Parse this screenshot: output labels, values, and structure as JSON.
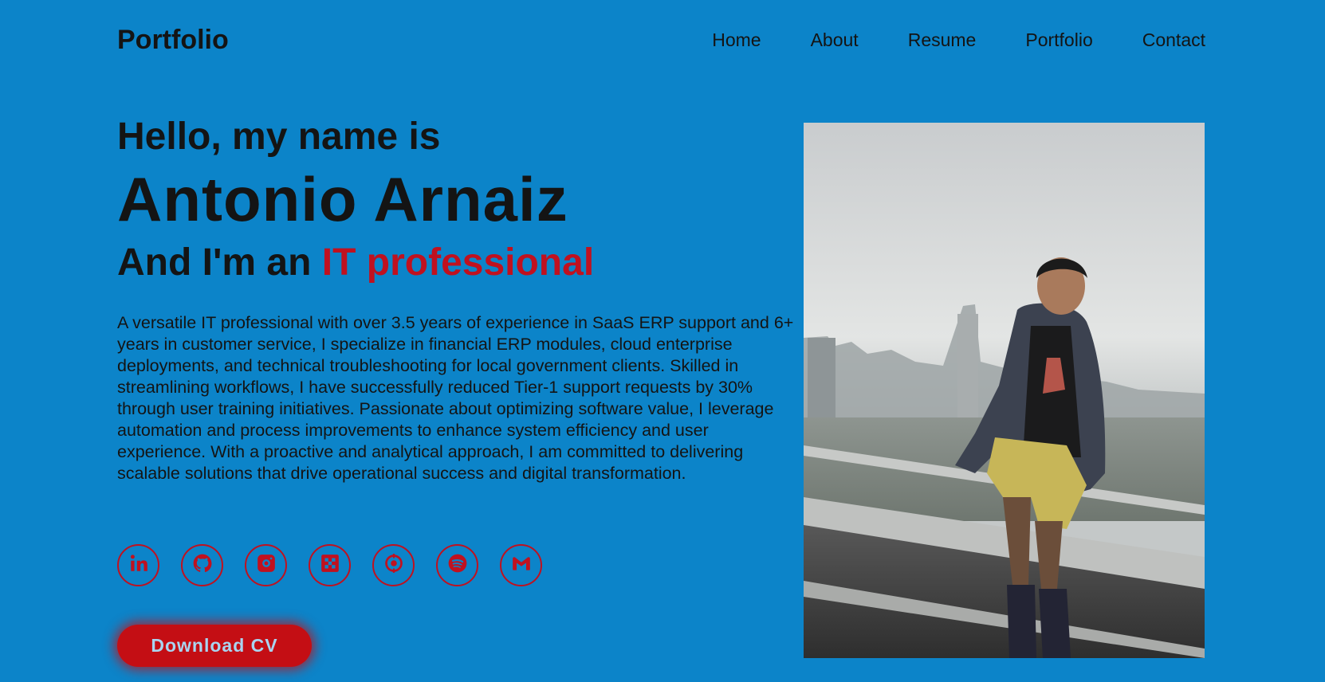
{
  "header": {
    "logo": "Portfolio",
    "nav": [
      "Home",
      "About",
      "Resume",
      "Portfolio",
      "Contact"
    ]
  },
  "hero": {
    "greeting": "Hello, my name is",
    "name": "Antonio Arnaiz",
    "role_prefix": "And I'm an ",
    "role_highlight": "IT professional",
    "bio": "A versatile IT professional with over 3.5 years of experience in SaaS ERP support and 6+ years in customer service, I specialize in financial ERP modules, cloud enterprise deployments, and technical troubleshooting for local government clients. Skilled in streamlining workflows, I have successfully reduced Tier-1 support requests by 30% through user training initiatives. Passionate about optimizing software value, I leverage automation and process improvements to enhance system efficiency and user experience. With a proactive and analytical approach, I am committed to delivering scalable solutions that drive operational success and digital transformation."
  },
  "socials": [
    {
      "icon": "linkedin-icon"
    },
    {
      "icon": "github-icon"
    },
    {
      "icon": "instagram-icon"
    },
    {
      "icon": "chess-icon"
    },
    {
      "icon": "target-icon"
    },
    {
      "icon": "spotify-icon"
    },
    {
      "icon": "gmail-icon"
    }
  ],
  "cta": {
    "download_cv": "Download CV"
  },
  "colors": {
    "background": "#0c84c9",
    "accent": "#c0111f",
    "button": "#c40e14",
    "button_text": "#a9d4f0"
  }
}
